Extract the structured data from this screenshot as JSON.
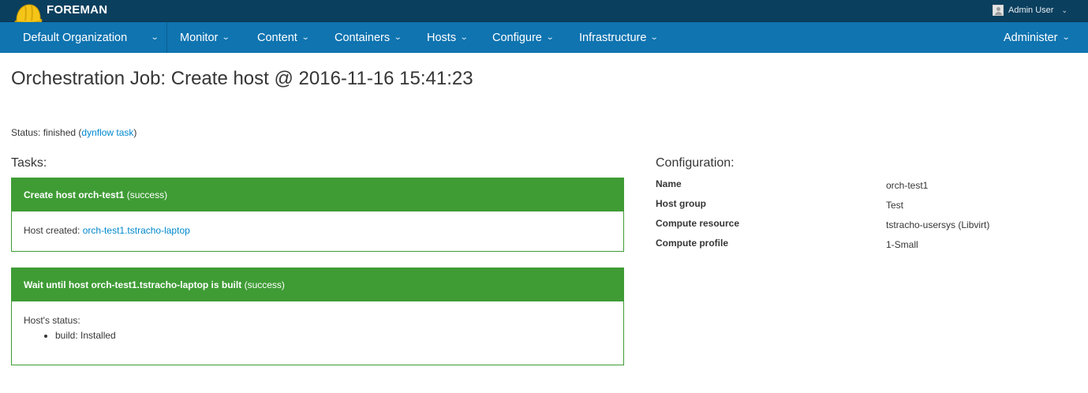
{
  "topbar": {
    "brand": "FOREMAN",
    "user_name": "Admin User"
  },
  "nav": {
    "org": "Default Organization",
    "items": [
      "Monitor",
      "Content",
      "Containers",
      "Hosts",
      "Configure",
      "Infrastructure"
    ],
    "right_item": "Administer"
  },
  "page": {
    "title": "Orchestration Job: Create host @ 2016-11-16 15:41:23",
    "status_prefix": "Status: finished (",
    "status_link": "dynflow task",
    "status_suffix": ")"
  },
  "tasks": {
    "heading": "Tasks:",
    "items": [
      {
        "title": "Create host orch-test1",
        "result": "(success)",
        "body_text": "Host created:",
        "body_link": "orch-test1.tstracho-laptop"
      },
      {
        "title": "Wait until host orch-test1.tstracho-laptop is built",
        "result": "(success)",
        "body_text": "Host's status:",
        "body_list": [
          "build: Installed"
        ]
      }
    ]
  },
  "configuration": {
    "heading": "Configuration:",
    "rows": [
      {
        "key": "Name",
        "value": "orch-test1"
      },
      {
        "key": "Host group",
        "value": "Test"
      },
      {
        "key": "Compute resource",
        "value": "tstracho-usersys (Libvirt)"
      },
      {
        "key": "Compute profile",
        "value": "1-Small"
      }
    ]
  },
  "colors": {
    "topbar": "#0b3f5e",
    "navbar": "#0f74b0",
    "success": "#3f9c35",
    "link": "#0088ce"
  },
  "icons": {
    "brand": "helmet-icon",
    "user": "user-avatar-icon",
    "dropdown": "chevron-down-icon"
  }
}
